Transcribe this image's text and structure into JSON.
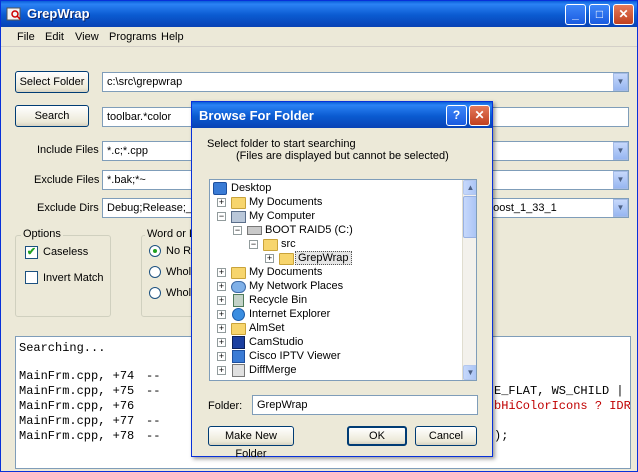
{
  "window": {
    "title": "GrepWrap",
    "controls": {
      "minimize": "_",
      "maximize": "□",
      "close": "✕"
    }
  },
  "menu": [
    "File",
    "Edit",
    "View",
    "Programs",
    "Help"
  ],
  "form": {
    "select_folder_label": "Select Folder",
    "folder_value": "c:\\src\\grepwrap",
    "search_label": "Search",
    "search_value": "toolbar.*color",
    "include_label": "Include Files",
    "include_value": "*.c;*.cpp",
    "exclude_label": "Exclude Files",
    "exclude_value": "*.bak;*~",
    "exclude_dirs_label": "Exclude Dirs",
    "exclude_dirs_value": "Debug;Release;_se",
    "exclude_dirs_value_right": "boost_1_33_1"
  },
  "options": {
    "title": "Options",
    "caseless": "Caseless",
    "invert": "Invert Match"
  },
  "word_group": {
    "title": "Word or L",
    "radio1": "No Re",
    "radio2": "Whole",
    "radio3": "Whole"
  },
  "results": {
    "status": "Searching...",
    "lines": [
      {
        "file": "MainFrm.cpp, +74",
        "sep": "--",
        "tail": ""
      },
      {
        "file": "MainFrm.cpp, +75",
        "sep": "--",
        "tail": "E_FLAT, WS_CHILD | W"
      },
      {
        "file": "MainFrm.cpp, +76",
        "sep": "",
        "tail": "bHiColorIcons ? IDR_"
      },
      {
        "file": "MainFrm.cpp, +77",
        "sep": "--",
        "tail": ""
      },
      {
        "file": "MainFrm.cpp, +78",
        "sep": "--",
        "tail": ");"
      }
    ]
  },
  "dialog": {
    "title": "Browse For Folder",
    "help_btn": "?",
    "close_btn": "✕",
    "instruction": "Select folder to start searching",
    "instruction_sub": "(Files are displayed but cannot be selected)",
    "tree": [
      "Desktop",
      "My Documents",
      "My Computer",
      "BOOT RAID5 (C:)",
      "src",
      "GrepWrap",
      "My Documents",
      "My Network Places",
      "Recycle Bin",
      "Internet Explorer",
      "AlmSet",
      "CamStudio",
      "Cisco IPTV Viewer",
      "DiffMerge"
    ],
    "folder_label": "Folder:",
    "folder_value": "GrepWrap",
    "make_new_folder": "Make New Folder",
    "ok": "OK",
    "cancel": "Cancel"
  }
}
